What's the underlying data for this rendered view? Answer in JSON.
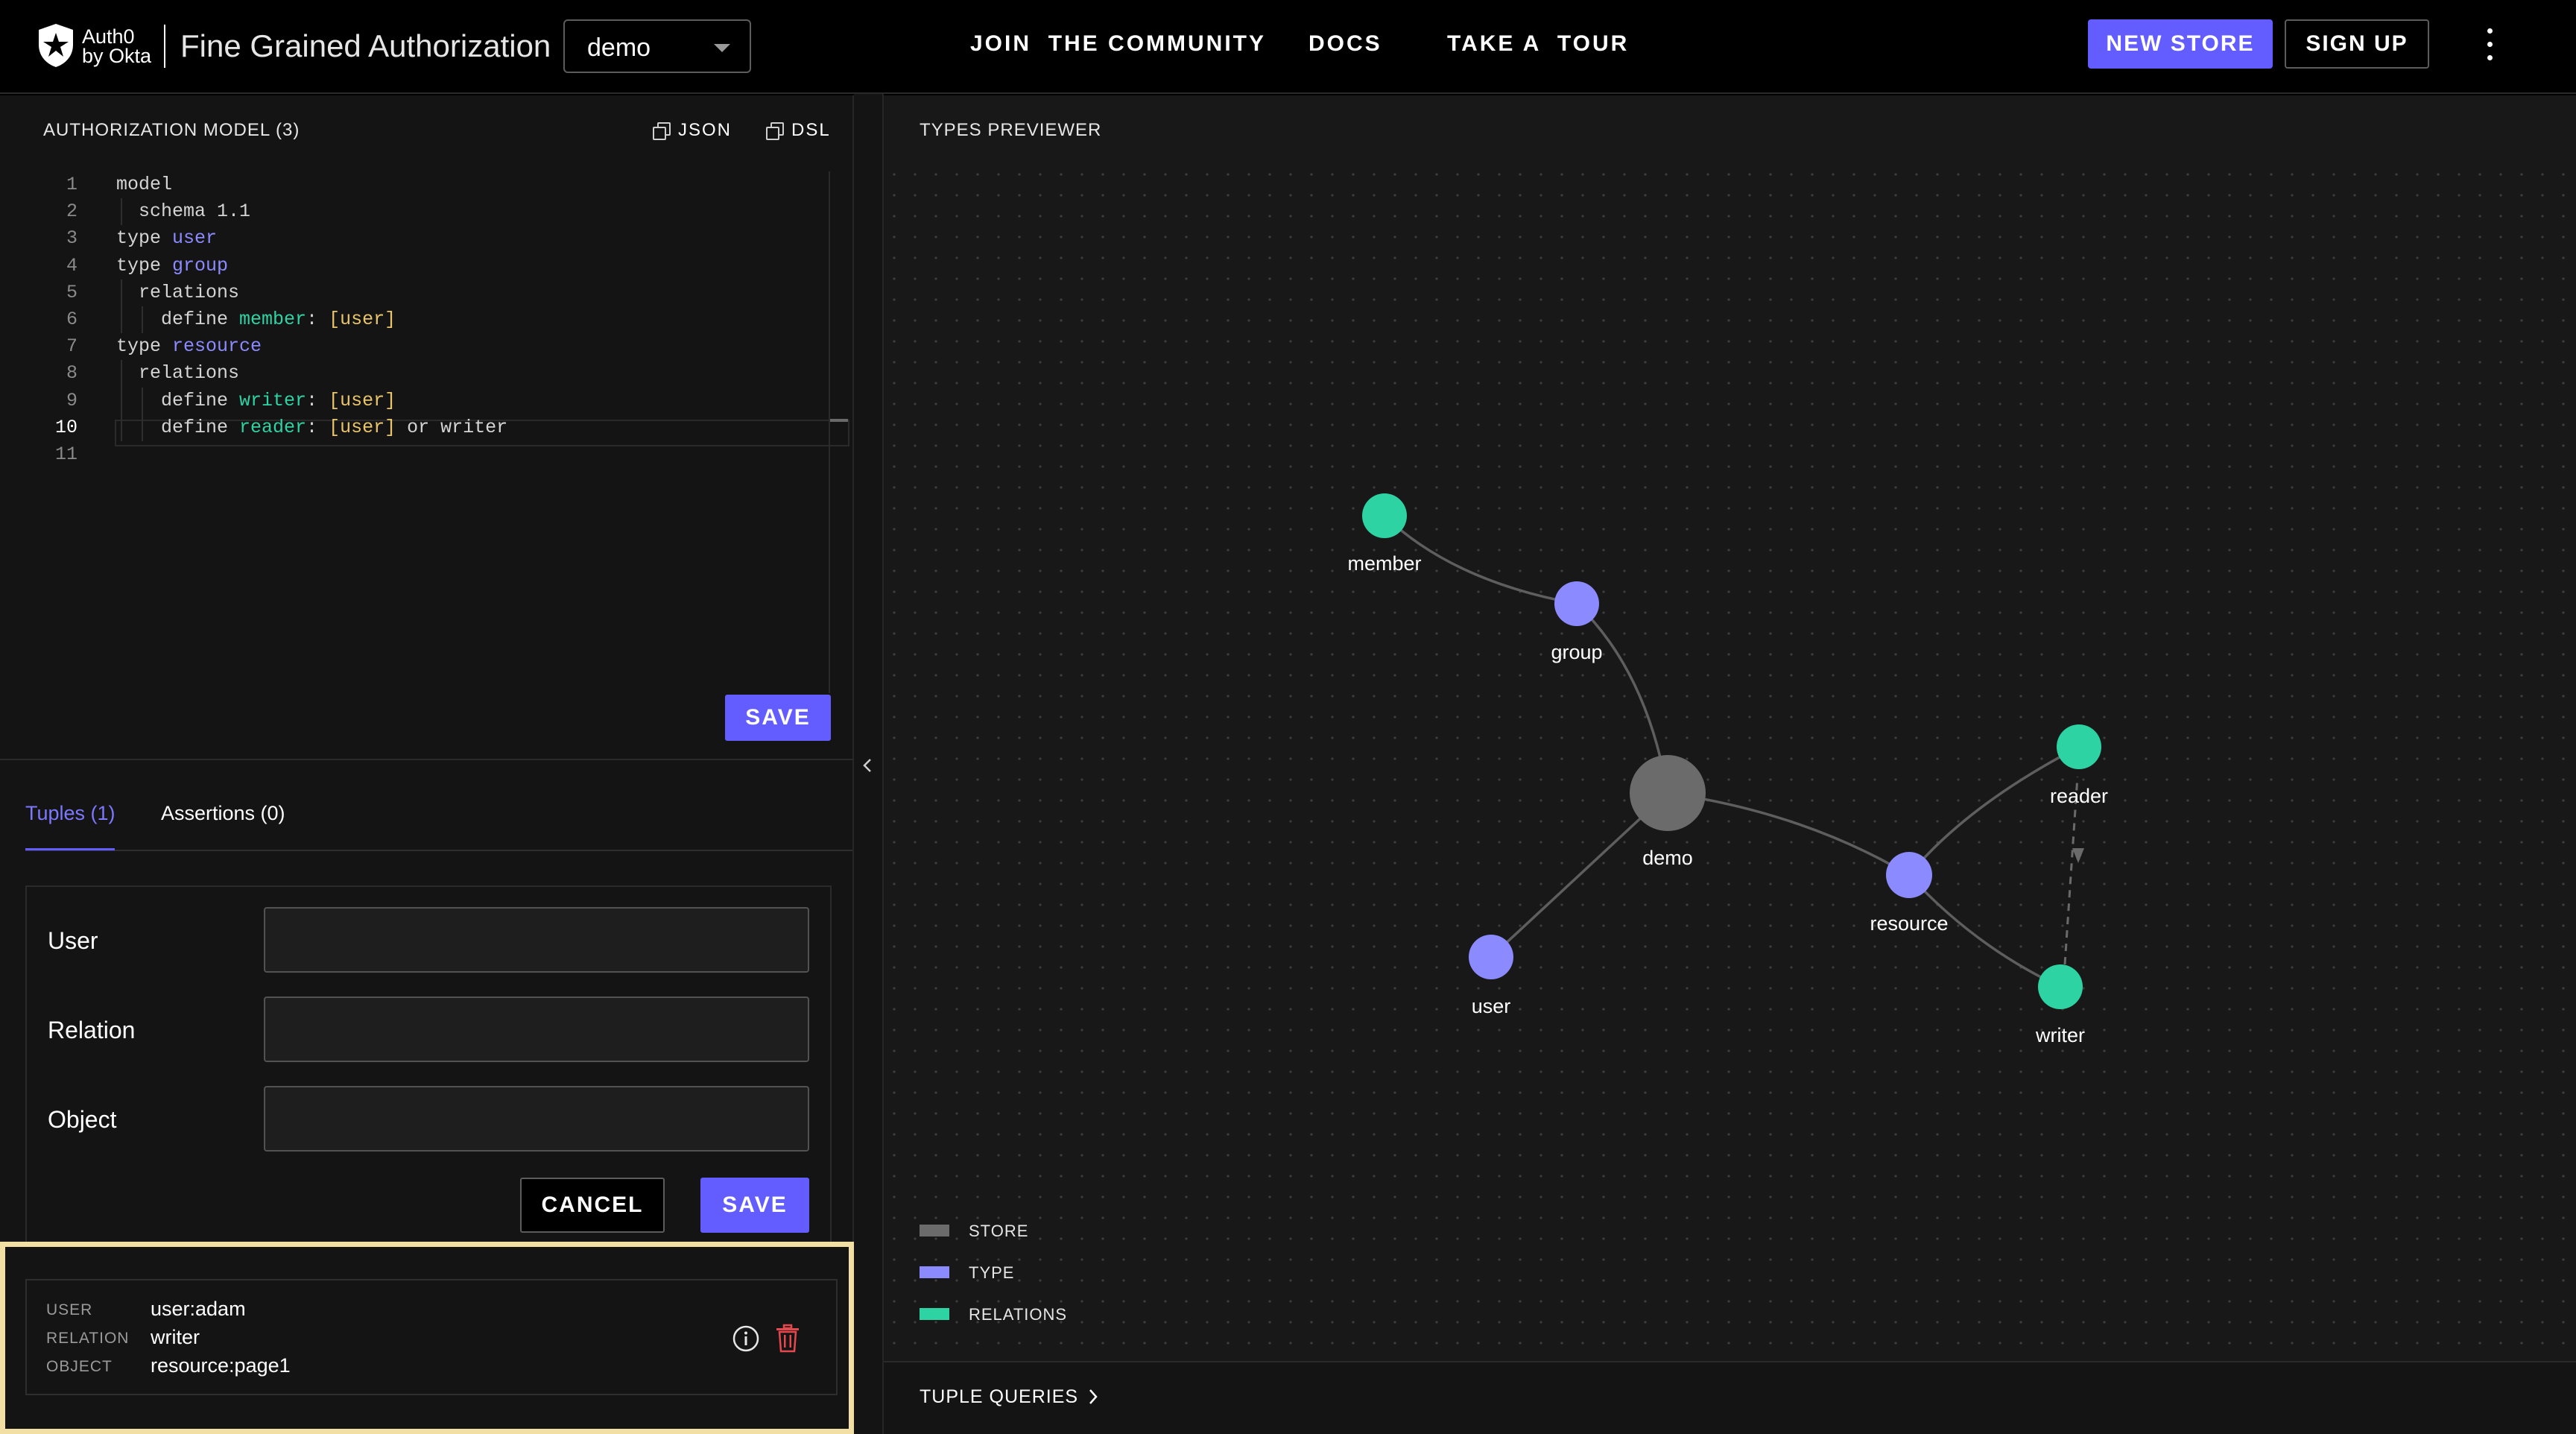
{
  "header": {
    "logo_line1": "Auth0",
    "logo_line2": "by Okta",
    "product_name": "Fine Grained Authorization",
    "store_selected": "demo",
    "nav": {
      "community": "JOIN  THE COMMUNITY",
      "docs": "DOCS",
      "tour": "TAKE A  TOUR"
    },
    "new_store_label": "NEW STORE",
    "sign_up_label": "SIGN UP"
  },
  "model_panel": {
    "title": "AUTHORIZATION MODEL (3)",
    "json_label": "JSON",
    "dsl_label": "DSL",
    "save_label": "SAVE",
    "active_line": 10,
    "lines": [
      [
        {
          "t": "model",
          "c": "kw"
        }
      ],
      [
        {
          "t": "  schema ",
          "c": "kw"
        },
        {
          "t": "1.1",
          "c": "val"
        }
      ],
      [
        {
          "t": "type ",
          "c": "kw"
        },
        {
          "t": "user",
          "c": "type"
        }
      ],
      [
        {
          "t": "type ",
          "c": "kw"
        },
        {
          "t": "group",
          "c": "type"
        }
      ],
      [
        {
          "t": "  relations",
          "c": "kw"
        }
      ],
      [
        {
          "t": "    define ",
          "c": "kw"
        },
        {
          "t": "member",
          "c": "rel"
        },
        {
          "t": ": ",
          "c": "kw"
        },
        {
          "t": "[user]",
          "c": "user"
        }
      ],
      [
        {
          "t": "type ",
          "c": "kw"
        },
        {
          "t": "resource",
          "c": "type"
        }
      ],
      [
        {
          "t": "  relations",
          "c": "kw"
        }
      ],
      [
        {
          "t": "    define ",
          "c": "kw"
        },
        {
          "t": "writer",
          "c": "rel"
        },
        {
          "t": ": ",
          "c": "kw"
        },
        {
          "t": "[user]",
          "c": "user"
        }
      ],
      [
        {
          "t": "    define ",
          "c": "kw"
        },
        {
          "t": "reader",
          "c": "rel"
        },
        {
          "t": ": ",
          "c": "kw"
        },
        {
          "t": "[user]",
          "c": "user"
        },
        {
          "t": " or writer",
          "c": "kw"
        }
      ],
      []
    ]
  },
  "tabs": {
    "tuples": "Tuples (1)",
    "assertions": "Assertions (0)"
  },
  "tuple_form": {
    "user_label": "User",
    "relation_label": "Relation",
    "object_label": "Object",
    "user_value": "",
    "relation_value": "",
    "object_value": "",
    "cancel_label": "CANCEL",
    "save_label": "SAVE"
  },
  "tuple": {
    "user_key": "USER",
    "user": "user:adam",
    "relation_key": "RELATION",
    "relation": "writer",
    "object_key": "OBJECT",
    "object": "resource:page1"
  },
  "types_previewer": {
    "title": "TYPES PREVIEWER",
    "nodes": {
      "member": "member",
      "group": "group",
      "demo": "demo",
      "user": "user",
      "resource": "resource",
      "reader": "reader",
      "writer": "writer"
    },
    "legend": {
      "store": "STORE",
      "type": "TYPE",
      "relations": "RELATIONS"
    },
    "colors": {
      "store": "#6b6b6b",
      "type": "#8b8bff",
      "relation": "#2ed3a3",
      "accent": "#635dff"
    }
  },
  "tuple_queries_label": "TUPLE QUERIES"
}
